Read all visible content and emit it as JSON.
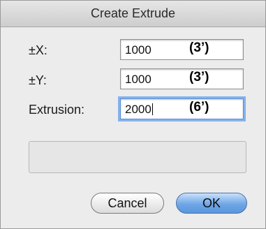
{
  "dialog": {
    "title": "Create Extrude"
  },
  "fields": {
    "x": {
      "label": "±X:",
      "value": "1000",
      "annotation": "(3’)"
    },
    "y": {
      "label": "±Y:",
      "value": "1000",
      "annotation": "(3’)"
    },
    "extrusion": {
      "label": "Extrusion:",
      "value": "2000",
      "annotation": "(6’)"
    }
  },
  "buttons": {
    "cancel_label": "Cancel",
    "ok_label": "OK"
  },
  "colors": {
    "focus_ring": "#86b2ec",
    "default_button": "#6fa6e6"
  }
}
